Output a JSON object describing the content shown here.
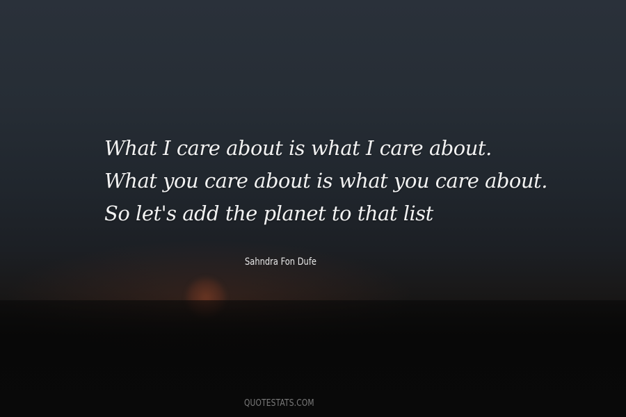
{
  "quote": {
    "lines": [
      "What I care about is what I care about.",
      "What you care about is what you care about.",
      "So let's add the planet to that list"
    ]
  },
  "author": "Sahndra Fon Dufe",
  "watermark": "QUOTESTATS.COM"
}
